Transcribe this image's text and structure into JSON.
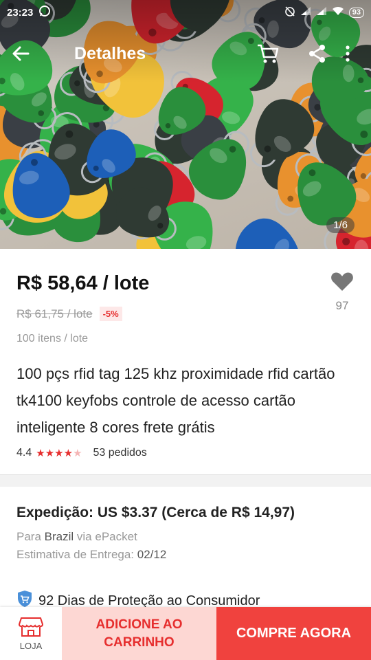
{
  "status_bar": {
    "time": "23:23",
    "battery": "93",
    "icons": [
      "whatsapp-icon",
      "alarm-icon",
      "signal-icon",
      "signal-icon",
      "wifi-icon",
      "battery-icon"
    ]
  },
  "app_bar": {
    "title": "Detalhes",
    "icons": [
      "back-arrow-icon",
      "cart-icon",
      "share-icon",
      "more-vert-icon"
    ]
  },
  "gallery": {
    "counter": "1/6"
  },
  "product": {
    "price": "R$ 58,64 / lote",
    "old_price": "R$ 61,75 / lote",
    "discount": "-5%",
    "lot_size": "100 itens / lote",
    "wishlist_count": "97",
    "title": "100 pçs rfid tag 125 khz proximidade rfid cartão tk4100 keyfobs controle de acesso cartão inteligente 8 cores frete grátis",
    "rating": "4.4",
    "rating_stars": 4.4,
    "orders": "53 pedidos"
  },
  "shipping": {
    "heading": "Expedição: US $3.37 (Cerca de R$ 14,97)",
    "to_prefix": "Para",
    "country": "Brazil",
    "via_prefix": "via",
    "method": "ePacket",
    "estimate_label": "Estimativa de Entrega:",
    "estimate_date": "02/12",
    "protection": "92 Dias de Proteção ao Consumidor"
  },
  "bottom_bar": {
    "store_label": "LOJA",
    "add_to_cart": "ADICIONE AO CARRINHO",
    "buy_now": "COMPRE AGORA"
  },
  "colors": {
    "accent": "#e62e2e",
    "buy_button": "#f0423e",
    "cart_button": "#fdd7d3"
  }
}
